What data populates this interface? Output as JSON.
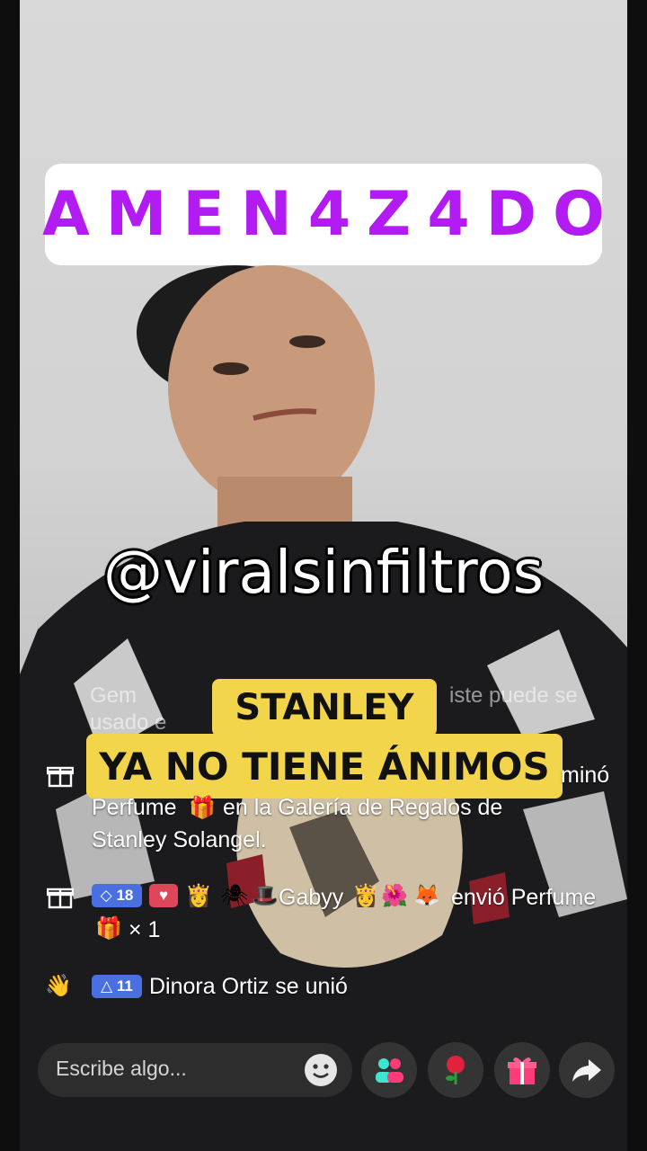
{
  "overlay": {
    "title": "AMEN4Z4DO",
    "handle": "@viralsinfiltros",
    "caption_line1": "STANLEY",
    "caption_line2": "YA NO TIENE ÁNIMOS"
  },
  "chat": {
    "ghost_line1_left": "Gem",
    "ghost_line1_right": "iste  puede se",
    "ghost_line2": "usado  e",
    "gift_message_right": "minó",
    "gift_message_line2": "Perfume",
    "gift_message_line2b": "en la Galería de Regalos de",
    "gift_message_line3": "Stanley Solangel.",
    "send_badge_level": "18",
    "send_user": "Gabyy",
    "send_action": "envió Perfume",
    "send_count": "× 1",
    "join_badge_level": "11",
    "join_text": "Dinora Ortiz se unió"
  },
  "input": {
    "placeholder": "Escribe algo..."
  },
  "icons": {
    "emoji": "emoji-icon",
    "guests": "guests-icon",
    "rose": "rose-gift-icon",
    "gift": "gift-icon",
    "share": "share-icon"
  },
  "colors": {
    "title": "#b21cf2",
    "caption_bg": "#f3d54b"
  }
}
